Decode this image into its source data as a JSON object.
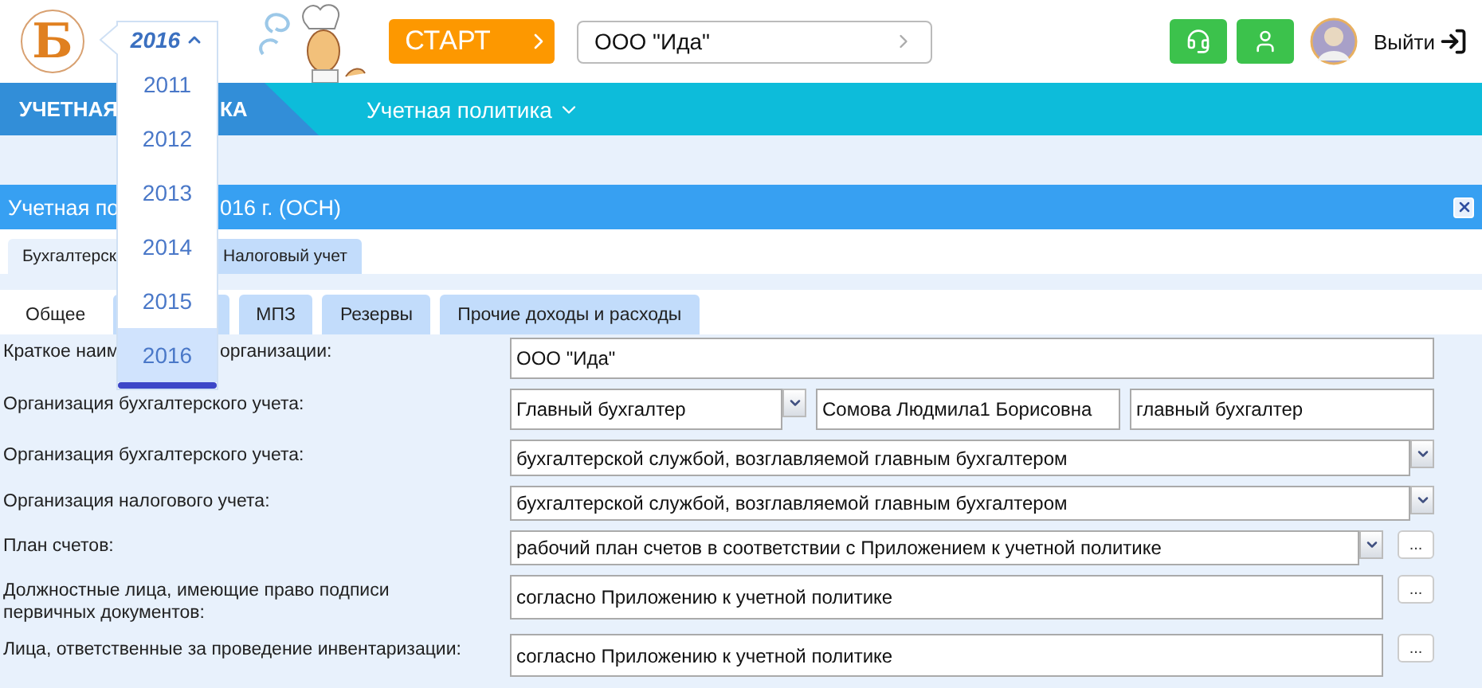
{
  "header": {
    "logo_text": "Б",
    "start_button": "СТАРТ",
    "company_field": {
      "value": "ООО \"Ида\""
    },
    "logout": "Выйти"
  },
  "year_selector": {
    "value": "2016",
    "expanded": true,
    "options": [
      {
        "label": "2011",
        "selected": false
      },
      {
        "label": "2012",
        "selected": false
      },
      {
        "label": "2013",
        "selected": false
      },
      {
        "label": "2014",
        "selected": false
      },
      {
        "label": "2015",
        "selected": false
      },
      {
        "label": "2016",
        "selected": true
      }
    ]
  },
  "nav": {
    "section_title_parts": [
      "УЧЕТНАЯ",
      "КА"
    ],
    "menu": "Учетная политика"
  },
  "panel": {
    "title_parts": [
      "Учетная по",
      "016 г. (ОСН)"
    ],
    "tabs": [
      {
        "label": "Бухгалтерск",
        "selected": true
      },
      {
        "label": "Налоговый учет",
        "selected": false
      }
    ],
    "subtabs": [
      {
        "label": "Общее",
        "selected": true
      },
      {
        "selected": false
      },
      {
        "label": "МПЗ",
        "selected": false
      },
      {
        "label": "Резервы",
        "selected": false
      },
      {
        "label": "Прочие доходы и расходы",
        "selected": false
      }
    ],
    "rows": [
      {
        "label_parts": [
          "Краткое наим",
          "организации:"
        ],
        "fields": [
          {
            "kind": "input",
            "value": "ООО \"Ида\""
          }
        ]
      },
      {
        "label_parts": [
          "Организация бухгалтерского учета:"
        ],
        "fields": [
          {
            "kind": "select",
            "value": "Главный бухгалтер"
          },
          {
            "kind": "input",
            "value": "Сомова Людмила1 Борисовна"
          },
          {
            "kind": "input",
            "value": "главный бухгалтер"
          }
        ]
      },
      {
        "label_parts": [
          "Организация бухгалтерского учета:"
        ],
        "fields": [
          {
            "kind": "select",
            "value": "бухгалтерской службой, возглавляемой главным бухгалтером"
          }
        ]
      },
      {
        "label_parts": [
          "Организация налогового учета:"
        ],
        "fields": [
          {
            "kind": "select",
            "value": "бухгалтерской службой, возглавляемой главным бухгалтером"
          }
        ]
      },
      {
        "label_parts": [
          "План счетов:"
        ],
        "fields": [
          {
            "kind": "select",
            "value": "рабочий план счетов в соответствии с Приложением к учетной политике"
          }
        ],
        "more_button": "..."
      },
      {
        "label_parts": [
          "Должностные лица, имеющие право подписи первичных документов:"
        ],
        "fields": [
          {
            "kind": "input",
            "value": "согласно Приложению к учетной политике"
          }
        ],
        "more_button": "..."
      },
      {
        "label_parts": [
          "Лица, ответственные за проведение инвентаризации:"
        ],
        "fields": [
          {
            "kind": "input",
            "value": "согласно Приложению к учетной политике"
          }
        ],
        "more_button": "..."
      }
    ]
  }
}
